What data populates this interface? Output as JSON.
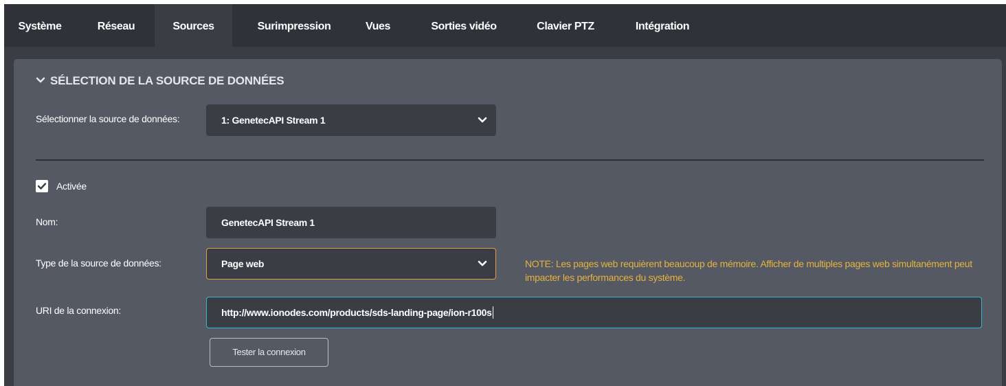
{
  "nav": {
    "tabs": [
      {
        "label": "Système"
      },
      {
        "label": "Réseau"
      },
      {
        "label": "Sources",
        "active": true
      },
      {
        "label": "Surimpression"
      },
      {
        "label": "Vues"
      },
      {
        "label": "Sorties vidéo"
      },
      {
        "label": "Clavier PTZ"
      },
      {
        "label": "Intégration"
      }
    ]
  },
  "section": {
    "title": "SÉLECTION DE LA SOURCE DE DONNÉES",
    "icon": "chevron-down-icon"
  },
  "form": {
    "source_select": {
      "label": "Sélectionner la source de données:",
      "value": "1: GenetecAPI Stream 1"
    },
    "enabled": {
      "label": "Activée",
      "checked": true
    },
    "name": {
      "label": "Nom:",
      "value": "GenetecAPI Stream 1"
    },
    "source_type": {
      "label": "Type de la source de données:",
      "value": "Page web"
    },
    "note": "NOTE: Les pages web requièrent beaucoup de mémoire. Afficher de multiples pages web simultanément peut impacter les performances du système.",
    "uri": {
      "label": "URI de la connexion:",
      "value": "http://www.ionodes.com/products/sds-landing-page/ion-r100s"
    },
    "test_button": "Tester la connexion"
  },
  "colors": {
    "nav_bg": "#2f3238",
    "page_bg": "#3a3d44",
    "panel_bg": "#555964",
    "field_bg": "#3a3d44",
    "focus_orange": "#e0a13a",
    "focus_teal": "#35b7d2",
    "note_text": "#e6b23e"
  }
}
